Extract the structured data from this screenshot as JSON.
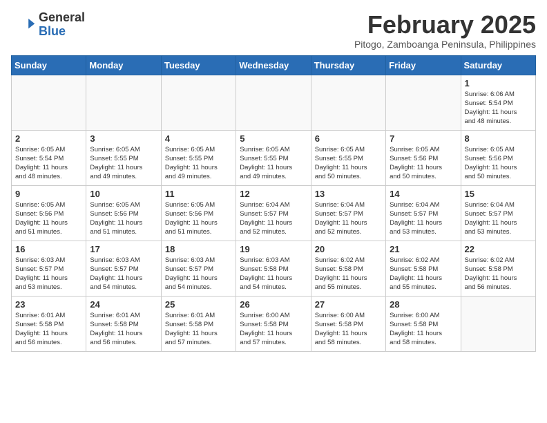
{
  "header": {
    "logo": {
      "general": "General",
      "blue": "Blue"
    },
    "title": "February 2025",
    "subtitle": "Pitogo, Zamboanga Peninsula, Philippines"
  },
  "weekdays": [
    "Sunday",
    "Monday",
    "Tuesday",
    "Wednesday",
    "Thursday",
    "Friday",
    "Saturday"
  ],
  "weeks": [
    [
      {
        "day": "",
        "info": ""
      },
      {
        "day": "",
        "info": ""
      },
      {
        "day": "",
        "info": ""
      },
      {
        "day": "",
        "info": ""
      },
      {
        "day": "",
        "info": ""
      },
      {
        "day": "",
        "info": ""
      },
      {
        "day": "1",
        "info": "Sunrise: 6:06 AM\nSunset: 5:54 PM\nDaylight: 11 hours\nand 48 minutes."
      }
    ],
    [
      {
        "day": "2",
        "info": "Sunrise: 6:05 AM\nSunset: 5:54 PM\nDaylight: 11 hours\nand 48 minutes."
      },
      {
        "day": "3",
        "info": "Sunrise: 6:05 AM\nSunset: 5:55 PM\nDaylight: 11 hours\nand 49 minutes."
      },
      {
        "day": "4",
        "info": "Sunrise: 6:05 AM\nSunset: 5:55 PM\nDaylight: 11 hours\nand 49 minutes."
      },
      {
        "day": "5",
        "info": "Sunrise: 6:05 AM\nSunset: 5:55 PM\nDaylight: 11 hours\nand 49 minutes."
      },
      {
        "day": "6",
        "info": "Sunrise: 6:05 AM\nSunset: 5:55 PM\nDaylight: 11 hours\nand 50 minutes."
      },
      {
        "day": "7",
        "info": "Sunrise: 6:05 AM\nSunset: 5:56 PM\nDaylight: 11 hours\nand 50 minutes."
      },
      {
        "day": "8",
        "info": "Sunrise: 6:05 AM\nSunset: 5:56 PM\nDaylight: 11 hours\nand 50 minutes."
      }
    ],
    [
      {
        "day": "9",
        "info": "Sunrise: 6:05 AM\nSunset: 5:56 PM\nDaylight: 11 hours\nand 51 minutes."
      },
      {
        "day": "10",
        "info": "Sunrise: 6:05 AM\nSunset: 5:56 PM\nDaylight: 11 hours\nand 51 minutes."
      },
      {
        "day": "11",
        "info": "Sunrise: 6:05 AM\nSunset: 5:56 PM\nDaylight: 11 hours\nand 51 minutes."
      },
      {
        "day": "12",
        "info": "Sunrise: 6:04 AM\nSunset: 5:57 PM\nDaylight: 11 hours\nand 52 minutes."
      },
      {
        "day": "13",
        "info": "Sunrise: 6:04 AM\nSunset: 5:57 PM\nDaylight: 11 hours\nand 52 minutes."
      },
      {
        "day": "14",
        "info": "Sunrise: 6:04 AM\nSunset: 5:57 PM\nDaylight: 11 hours\nand 53 minutes."
      },
      {
        "day": "15",
        "info": "Sunrise: 6:04 AM\nSunset: 5:57 PM\nDaylight: 11 hours\nand 53 minutes."
      }
    ],
    [
      {
        "day": "16",
        "info": "Sunrise: 6:03 AM\nSunset: 5:57 PM\nDaylight: 11 hours\nand 53 minutes."
      },
      {
        "day": "17",
        "info": "Sunrise: 6:03 AM\nSunset: 5:57 PM\nDaylight: 11 hours\nand 54 minutes."
      },
      {
        "day": "18",
        "info": "Sunrise: 6:03 AM\nSunset: 5:57 PM\nDaylight: 11 hours\nand 54 minutes."
      },
      {
        "day": "19",
        "info": "Sunrise: 6:03 AM\nSunset: 5:58 PM\nDaylight: 11 hours\nand 54 minutes."
      },
      {
        "day": "20",
        "info": "Sunrise: 6:02 AM\nSunset: 5:58 PM\nDaylight: 11 hours\nand 55 minutes."
      },
      {
        "day": "21",
        "info": "Sunrise: 6:02 AM\nSunset: 5:58 PM\nDaylight: 11 hours\nand 55 minutes."
      },
      {
        "day": "22",
        "info": "Sunrise: 6:02 AM\nSunset: 5:58 PM\nDaylight: 11 hours\nand 56 minutes."
      }
    ],
    [
      {
        "day": "23",
        "info": "Sunrise: 6:01 AM\nSunset: 5:58 PM\nDaylight: 11 hours\nand 56 minutes."
      },
      {
        "day": "24",
        "info": "Sunrise: 6:01 AM\nSunset: 5:58 PM\nDaylight: 11 hours\nand 56 minutes."
      },
      {
        "day": "25",
        "info": "Sunrise: 6:01 AM\nSunset: 5:58 PM\nDaylight: 11 hours\nand 57 minutes."
      },
      {
        "day": "26",
        "info": "Sunrise: 6:00 AM\nSunset: 5:58 PM\nDaylight: 11 hours\nand 57 minutes."
      },
      {
        "day": "27",
        "info": "Sunrise: 6:00 AM\nSunset: 5:58 PM\nDaylight: 11 hours\nand 58 minutes."
      },
      {
        "day": "28",
        "info": "Sunrise: 6:00 AM\nSunset: 5:58 PM\nDaylight: 11 hours\nand 58 minutes."
      },
      {
        "day": "",
        "info": ""
      }
    ]
  ]
}
